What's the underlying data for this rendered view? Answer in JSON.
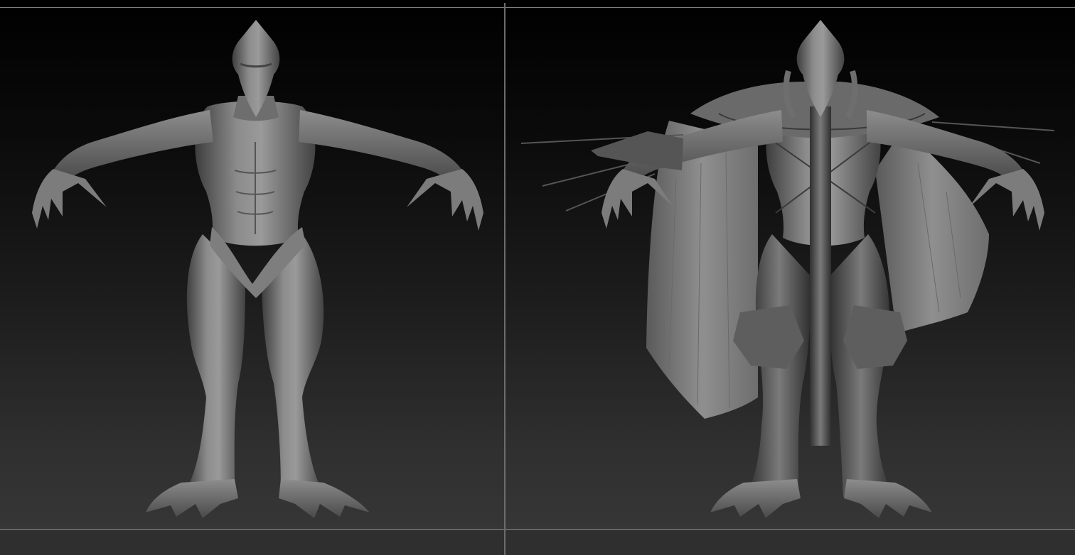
{
  "window": {
    "title": ""
  },
  "viewports": [
    {
      "id": "left",
      "view": "front",
      "model": "body-sculpt"
    },
    {
      "id": "right",
      "view": "front",
      "model": "armored-sculpt"
    }
  ],
  "colors": {
    "background_top": "#000000",
    "background_bottom": "#383838",
    "mesh": "#8a8a8a",
    "mesh_shadow": "#3c3c3c",
    "cape": "#8f8f8f",
    "frame_line": "#7e7e7e"
  }
}
